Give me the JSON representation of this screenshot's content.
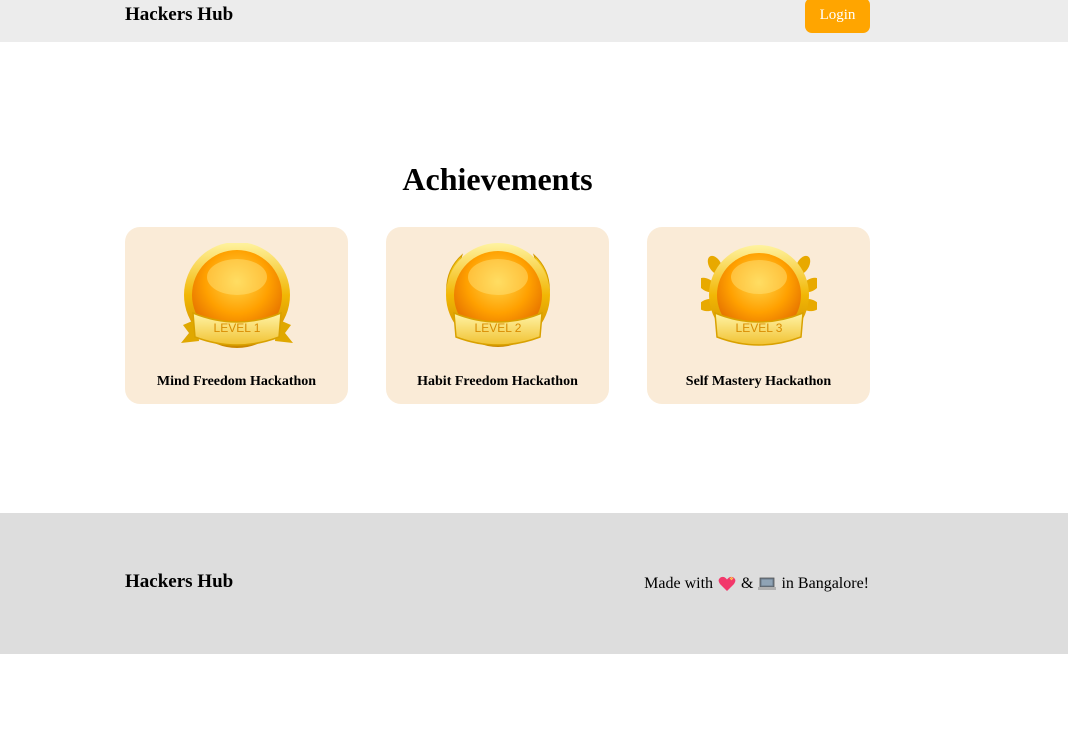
{
  "navbar": {
    "brand": "Hackers Hub",
    "login_label": "Login"
  },
  "main": {
    "title": "Achievements",
    "achievements": [
      {
        "badge_text": "LEVEL 1",
        "label": "Mind Freedom Hackathon",
        "icon": "level-1-medal-icon"
      },
      {
        "badge_text": "LEVEL 2",
        "label": "Habit Freedom Hackathon",
        "icon": "level-2-medal-icon"
      },
      {
        "badge_text": "LEVEL 3",
        "label": "Self Mastery Hackathon",
        "icon": "level-3-medal-icon"
      }
    ]
  },
  "footer": {
    "brand": "Hackers Hub",
    "made_with": "Made with",
    "and": "&",
    "location": "in Bangalore!",
    "icons": [
      "heart-icon",
      "laptop-icon"
    ]
  },
  "colors": {
    "navbar_bg": "#ececec",
    "login_bg": "#ffa500",
    "card_bg": "#faebd7",
    "footer_bg": "#dddddd",
    "medal_gold": "#f6b800",
    "medal_orange": "#ff9800"
  }
}
